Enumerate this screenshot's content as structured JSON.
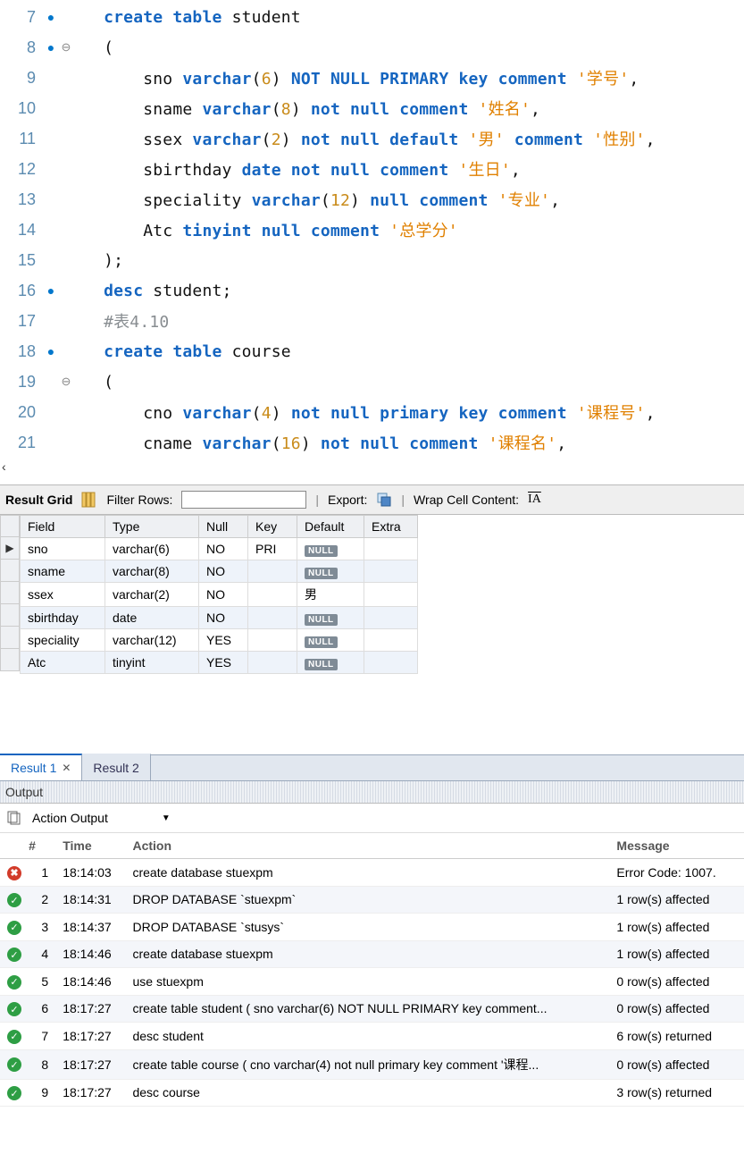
{
  "editor": {
    "lines": [
      {
        "num": "7",
        "bullet": true,
        "fold": "",
        "segments": [
          [
            "  ",
            ""
          ],
          [
            "create table ",
            "kw"
          ],
          [
            "student",
            "ident"
          ]
        ]
      },
      {
        "num": "8",
        "bullet": true,
        "fold": "⊖",
        "segments": [
          [
            "  (",
            "ident"
          ]
        ]
      },
      {
        "num": "9",
        "bullet": false,
        "fold": "",
        "segments": [
          [
            "      sno ",
            "ident"
          ],
          [
            "varchar",
            "kw"
          ],
          [
            "(",
            "ident"
          ],
          [
            "6",
            "num"
          ],
          [
            ") ",
            "ident"
          ],
          [
            "NOT NULL PRIMARY key comment ",
            "kw2"
          ],
          [
            "'学号'",
            "str"
          ],
          [
            ",",
            "ident"
          ]
        ]
      },
      {
        "num": "10",
        "bullet": false,
        "fold": "",
        "segments": [
          [
            "      sname ",
            "ident"
          ],
          [
            "varchar",
            "kw"
          ],
          [
            "(",
            "ident"
          ],
          [
            "8",
            "num"
          ],
          [
            ") ",
            "ident"
          ],
          [
            "not null comment ",
            "kw2"
          ],
          [
            "'姓名'",
            "str"
          ],
          [
            ",",
            "ident"
          ]
        ]
      },
      {
        "num": "11",
        "bullet": false,
        "fold": "",
        "segments": [
          [
            "      ssex ",
            "ident"
          ],
          [
            "varchar",
            "kw"
          ],
          [
            "(",
            "ident"
          ],
          [
            "2",
            "num"
          ],
          [
            ") ",
            "ident"
          ],
          [
            "not null default ",
            "kw2"
          ],
          [
            "'男' ",
            "str"
          ],
          [
            "comment ",
            "kw2"
          ],
          [
            "'性别'",
            "str"
          ],
          [
            ",",
            "ident"
          ]
        ]
      },
      {
        "num": "12",
        "bullet": false,
        "fold": "",
        "segments": [
          [
            "      sbirthday ",
            "ident"
          ],
          [
            "date not null comment ",
            "kw2"
          ],
          [
            "'生日'",
            "str"
          ],
          [
            ",",
            "ident"
          ]
        ]
      },
      {
        "num": "13",
        "bullet": false,
        "fold": "",
        "segments": [
          [
            "      speciality ",
            "ident"
          ],
          [
            "varchar",
            "kw"
          ],
          [
            "(",
            "ident"
          ],
          [
            "12",
            "num"
          ],
          [
            ") ",
            "ident"
          ],
          [
            "null comment ",
            "kw2"
          ],
          [
            "'专业'",
            "str"
          ],
          [
            ",",
            "ident"
          ]
        ]
      },
      {
        "num": "14",
        "bullet": false,
        "fold": "",
        "segments": [
          [
            "      Atc ",
            "ident"
          ],
          [
            "tinyint null comment ",
            "kw2"
          ],
          [
            "'总学分'",
            "str"
          ]
        ]
      },
      {
        "num": "15",
        "bullet": false,
        "fold": "",
        "segments": [
          [
            "  );",
            "ident"
          ]
        ]
      },
      {
        "num": "16",
        "bullet": true,
        "fold": "",
        "segments": [
          [
            "  ",
            ""
          ],
          [
            "desc ",
            "kw"
          ],
          [
            "student;",
            "ident"
          ]
        ]
      },
      {
        "num": "17",
        "bullet": false,
        "fold": "",
        "segments": [
          [
            "  #表4.10",
            "cmt"
          ]
        ]
      },
      {
        "num": "18",
        "bullet": true,
        "fold": "",
        "segments": [
          [
            "  ",
            ""
          ],
          [
            "create table ",
            "kw"
          ],
          [
            "course",
            "ident"
          ]
        ]
      },
      {
        "num": "19",
        "bullet": false,
        "fold": "⊖",
        "segments": [
          [
            "  (",
            "ident"
          ]
        ]
      },
      {
        "num": "20",
        "bullet": false,
        "fold": "",
        "segments": [
          [
            "      cno ",
            "ident"
          ],
          [
            "varchar",
            "kw"
          ],
          [
            "(",
            "ident"
          ],
          [
            "4",
            "num"
          ],
          [
            ") ",
            "ident"
          ],
          [
            "not null primary key comment ",
            "kw2"
          ],
          [
            "'课程号'",
            "str"
          ],
          [
            ",",
            "ident"
          ]
        ]
      },
      {
        "num": "21",
        "bullet": false,
        "fold": "",
        "segments": [
          [
            "      cname ",
            "ident"
          ],
          [
            "varchar",
            "kw"
          ],
          [
            "(",
            "ident"
          ],
          [
            "16",
            "num"
          ],
          [
            ") ",
            "ident"
          ],
          [
            "not null comment ",
            "kw2"
          ],
          [
            "'课程名'",
            "str"
          ],
          [
            ",",
            "ident"
          ]
        ]
      }
    ]
  },
  "close_chevron": "‹",
  "grid_toolbar": {
    "result_grid": "Result Grid",
    "filter_rows": "Filter Rows:",
    "export": "Export:",
    "wrap": "Wrap Cell Content:",
    "wrap_icon": "⇅A"
  },
  "grid": {
    "headers": [
      "Field",
      "Type",
      "Null",
      "Key",
      "Default",
      "Extra"
    ],
    "widths": [
      95,
      105,
      55,
      55,
      75,
      60
    ],
    "rows": [
      {
        "cells": [
          "sno",
          "varchar(6)",
          "NO",
          "PRI",
          null,
          ""
        ],
        "pointer": true
      },
      {
        "cells": [
          "sname",
          "varchar(8)",
          "NO",
          "",
          null,
          ""
        ]
      },
      {
        "cells": [
          "ssex",
          "varchar(2)",
          "NO",
          "",
          "男",
          ""
        ]
      },
      {
        "cells": [
          "sbirthday",
          "date",
          "NO",
          "",
          null,
          ""
        ]
      },
      {
        "cells": [
          "speciality",
          "varchar(12)",
          "YES",
          "",
          null,
          ""
        ]
      },
      {
        "cells": [
          "Atc",
          "tinyint",
          "YES",
          "",
          null,
          ""
        ]
      }
    ],
    "null_label": "NULL"
  },
  "tabs": [
    {
      "label": "Result 1",
      "active": true,
      "closable": true
    },
    {
      "label": "Result 2",
      "active": false,
      "closable": false
    }
  ],
  "output": {
    "title": "Output",
    "dropdown": "Action Output",
    "headers": [
      "",
      "#",
      "Time",
      "Action",
      "Message"
    ],
    "rows": [
      {
        "status": "err",
        "n": "1",
        "time": "18:14:03",
        "action": "create database stuexpm",
        "msg": "Error Code: 1007."
      },
      {
        "status": "ok",
        "n": "2",
        "time": "18:14:31",
        "action": "DROP DATABASE `stuexpm`",
        "msg": "1 row(s) affected"
      },
      {
        "status": "ok",
        "n": "3",
        "time": "18:14:37",
        "action": "DROP DATABASE `stusys`",
        "msg": "1 row(s) affected"
      },
      {
        "status": "ok",
        "n": "4",
        "time": "18:14:46",
        "action": "create database stuexpm",
        "msg": "1 row(s) affected"
      },
      {
        "status": "ok",
        "n": "5",
        "time": "18:14:46",
        "action": "use stuexpm",
        "msg": "0 row(s) affected"
      },
      {
        "status": "ok",
        "n": "6",
        "time": "18:17:27",
        "action": "create table student ( sno varchar(6) NOT NULL PRIMARY key comment...",
        "msg": "0 row(s) affected"
      },
      {
        "status": "ok",
        "n": "7",
        "time": "18:17:27",
        "action": "desc student",
        "msg": "6 row(s) returned"
      },
      {
        "status": "ok",
        "n": "8",
        "time": "18:17:27",
        "action": "create table course ( cno varchar(4) not null primary key comment '课程...",
        "msg": "0 row(s) affected"
      },
      {
        "status": "ok",
        "n": "9",
        "time": "18:17:27",
        "action": "desc course",
        "msg": "3 row(s) returned"
      }
    ]
  }
}
